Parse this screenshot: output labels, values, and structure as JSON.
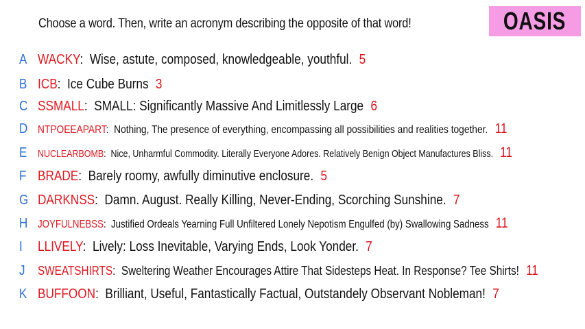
{
  "prompt": "Choose a word. Then, write an acronym describing the opposite of that word!",
  "logo": "OASIS",
  "colors": {
    "accent_red": "#e0171f",
    "letter_blue": "#2b6fd8",
    "logo_bg": "#f59ce4"
  },
  "entries": [
    {
      "letter": "A",
      "word": "WACKY",
      "definition": "Wise, astute, composed, knowledgeable, youthful.",
      "count": "5"
    },
    {
      "letter": "B",
      "word": "ICB",
      "definition": "Ice Cube  Burns",
      "count": "3"
    },
    {
      "letter": "C",
      "word": "SSMALL",
      "definition": "SMALL: Significantly Massive And Limitlessly Large",
      "count": "6"
    },
    {
      "letter": "D",
      "word": "NTPOEEAPART",
      "definition": "Nothing, The presence of everything, encompassing all possibilities and realities together.",
      "count": "11"
    },
    {
      "letter": "E",
      "word": "NUCLEARBOMB",
      "definition": "Nice, Unharmful Commodity. Literally Everyone Adores. Relatively Benign Object Manufactures Bliss.",
      "count": "11"
    },
    {
      "letter": "F",
      "word": "BRADE",
      "definition": "Barely roomy, awfully diminutive enclosure.",
      "count": "5"
    },
    {
      "letter": "G",
      "word": "DARKNSS",
      "definition": "Damn. August. Really Killing, Never-Ending, Scorching Sunshine.",
      "count": "7"
    },
    {
      "letter": "H",
      "word": "JOYFULNEBSS",
      "definition": "Justified Ordeals Yearning Full Unfiltered Lonely Nepotism Engulfed (by) Swallowing Sadness",
      "count": "11"
    },
    {
      "letter": "I",
      "word": "LLIVELY",
      "definition": "Lively: Loss Inevitable, Varying Ends, Look Yonder.",
      "count": "7"
    },
    {
      "letter": "J",
      "word": "SWEATSHIRTS",
      "definition": "Sweltering Weather Encourages Attire That Sidesteps Heat. In Response? Tee Shirts!",
      "count": "11"
    },
    {
      "letter": "K",
      "word": "BUFFOON",
      "definition": "Brilliant, Useful, Fantastically Factual, Outstandely Observant Nobleman!",
      "count": "7"
    }
  ]
}
